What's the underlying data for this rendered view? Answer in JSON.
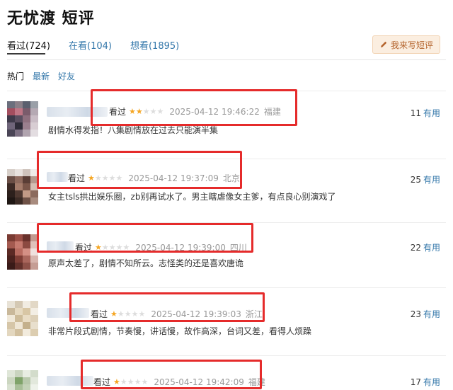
{
  "page": {
    "title": "无忧渡 短评"
  },
  "tabs": [
    {
      "label": "看过",
      "count": "(724)"
    },
    {
      "label": "在看",
      "count": "(104)"
    },
    {
      "label": "想看",
      "count": "(1895)"
    }
  ],
  "write_button": {
    "label": "我来写短评",
    "icon": "pencil-icon"
  },
  "sort": [
    "热门",
    "最新",
    "好友"
  ],
  "comments": [
    {
      "status": "看过",
      "rating": 2,
      "time": "2025-04-12 19:46:22",
      "location": "福建",
      "text": "剧情水得发指！八集剧情放在过去只能演半集",
      "useful_count": "11",
      "useful_label": "有用"
    },
    {
      "status": "看过",
      "rating": 1,
      "time": "2025-04-12 19:37:09",
      "location": "北京",
      "text": "女主tsls拱出娱乐圈，zb别再试水了。男主瞎虐像女主爹，有点良心别演戏了",
      "useful_count": "25",
      "useful_label": "有用"
    },
    {
      "status": "看过",
      "rating": 1,
      "time": "2025-04-12 19:39:00",
      "location": "四川",
      "text": "原声太差了，剧情不知所云。志怪类的还是喜欢唐诡",
      "useful_count": "22",
      "useful_label": "有用"
    },
    {
      "status": "看过",
      "rating": 1,
      "time": "2025-04-12 19:39:03",
      "location": "浙江",
      "text": "非常片段式剧情，节奏慢，讲话慢，故作高深，台词又差，看得人烦躁",
      "useful_count": "23",
      "useful_label": "有用"
    },
    {
      "status": "看过",
      "rating": 1,
      "time": "2025-04-12 19:42:09",
      "location": "福建",
      "text": "",
      "useful_count": "17",
      "useful_label": "有用"
    }
  ],
  "colors": {
    "accent_link": "#3377aa",
    "star": "#f5a623",
    "highlight_box": "#e52b2b",
    "write_button_bg": "#fbeee0"
  }
}
